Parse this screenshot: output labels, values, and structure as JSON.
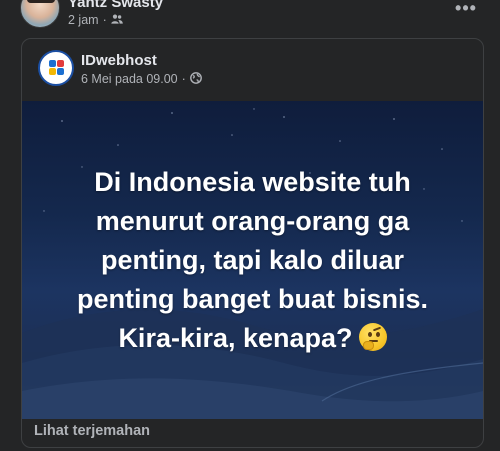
{
  "post": {
    "author": "Yantz Swasty",
    "time": "2 jam",
    "audience_icon": "friends-icon",
    "more_label": "•••"
  },
  "shared": {
    "page_name": "IDwebhost",
    "date": "6 Mei pada 09.00",
    "audience_icon": "globe-icon",
    "image_text_lines": [
      "Di Indonesia website tuh",
      "menurut orang-orang ga",
      "penting, tapi kalo diluar",
      "penting banget buat bisnis.",
      "Kira-kira, kenapa?"
    ],
    "emoji": "thinking-face-icon",
    "translation_link": "Lihat terjemahan"
  },
  "colors": {
    "background": "#242526",
    "primary_text": "#e4e6eb",
    "secondary_text": "#b0b3b8",
    "border": "#3e4042",
    "image_top": "#0f1d3c",
    "image_bottom": "#243a63"
  }
}
